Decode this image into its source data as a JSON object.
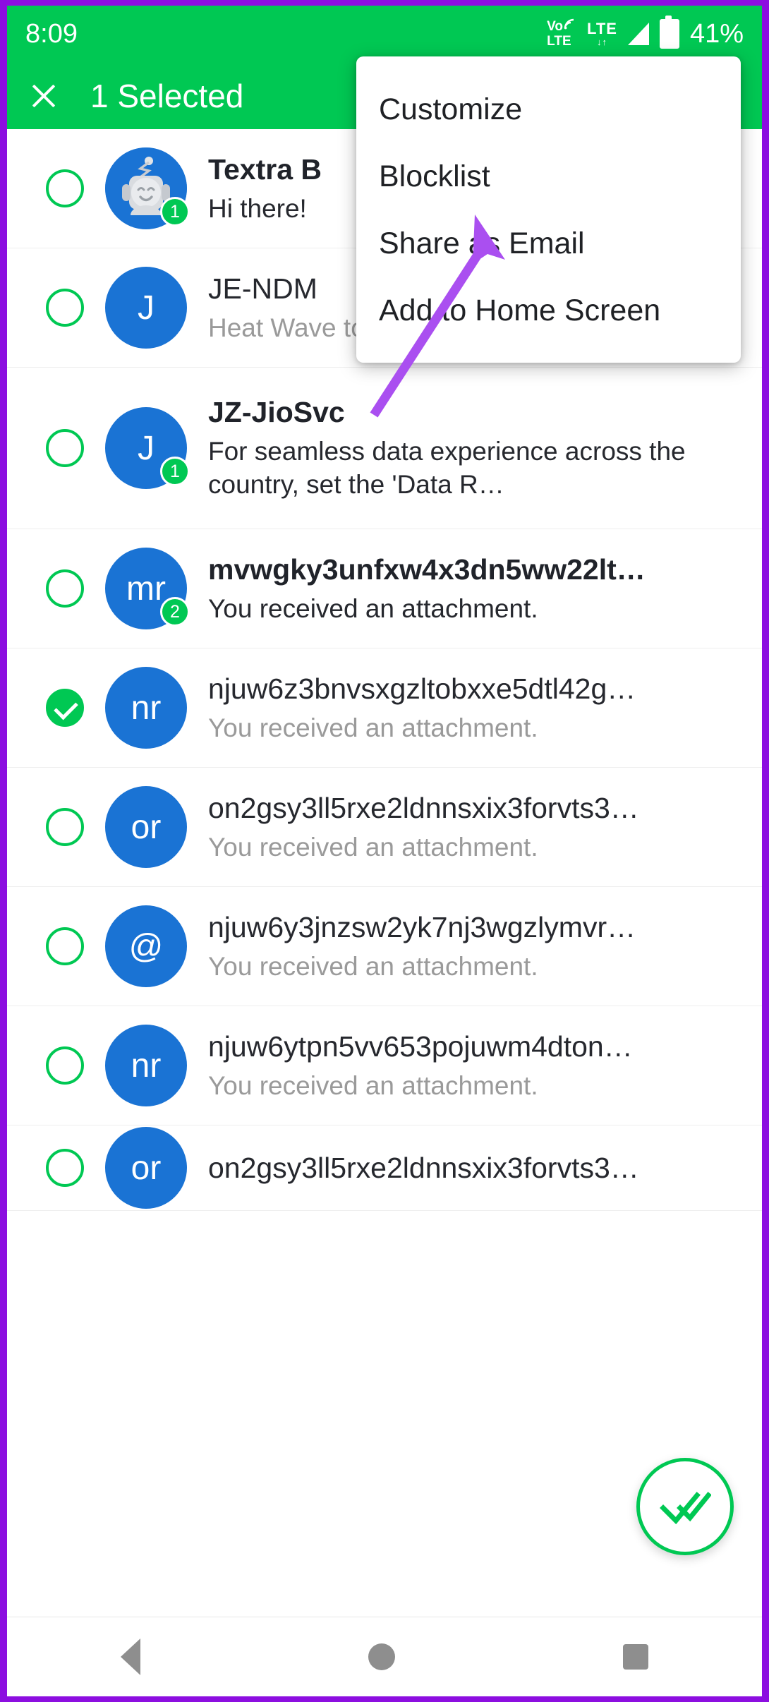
{
  "statusbar": {
    "clock": "8:09",
    "volte_top": "Vo",
    "volte_bottom": "LTE",
    "lte_label": "LTE",
    "lte_arrows": "↓↑",
    "battery_percent": "41%",
    "icons": [
      "volte-icon",
      "lte-data-icon",
      "signal-bars-icon",
      "battery-icon"
    ]
  },
  "actionbar": {
    "close_label": "✕",
    "title": "1 Selected",
    "background": "#00c853"
  },
  "popup_menu": {
    "items": [
      {
        "label": "Customize"
      },
      {
        "label": "Blocklist"
      },
      {
        "label": "Share as Email"
      },
      {
        "label": "Add to Home Screen"
      }
    ]
  },
  "conversations": [
    {
      "avatar_text": "",
      "avatar_type": "robot",
      "badge": "1",
      "title": "Textra B",
      "preview": "Hi there!",
      "unread": true,
      "selected": false,
      "two_line": false
    },
    {
      "avatar_text": "J",
      "avatar_type": "letter",
      "badge": "",
      "title": "JE-NDM",
      "preview": "Heat Wave to Severe Heat Wave c…",
      "unread": false,
      "selected": false,
      "two_line": false
    },
    {
      "avatar_text": "J",
      "avatar_type": "letter",
      "badge": "1",
      "title": "JZ-JioSvc",
      "preview": "For seamless data experience across the country, set the 'Data R…",
      "unread": true,
      "selected": false,
      "two_line": true
    },
    {
      "avatar_text": "mr",
      "avatar_type": "letter",
      "badge": "2",
      "title": "mvwgky3unfxw4x3dn5ww22lt…",
      "preview": "You received an attachment.",
      "unread": true,
      "selected": false,
      "two_line": false
    },
    {
      "avatar_text": "nr",
      "avatar_type": "letter",
      "badge": "",
      "title": "njuw6z3bnvsxgzltobxxe5dtl42g…",
      "preview": "You received an attachment.",
      "unread": false,
      "selected": true,
      "two_line": false
    },
    {
      "avatar_text": "or",
      "avatar_type": "letter",
      "badge": "",
      "title": "on2gsy3ll5rxe2ldnnsxix3forvts3…",
      "preview": "You received an attachment.",
      "unread": false,
      "selected": false,
      "two_line": false
    },
    {
      "avatar_text": "@",
      "avatar_type": "letter",
      "badge": "",
      "title": "njuw6y3jnzsw2yk7nj3wgzlymvr…",
      "preview": "You received an attachment.",
      "unread": false,
      "selected": false,
      "two_line": false
    },
    {
      "avatar_text": "nr",
      "avatar_type": "letter",
      "badge": "",
      "title": "njuw6ytpn5vv653pojuwm4dton…",
      "preview": "You received an attachment.",
      "unread": false,
      "selected": false,
      "two_line": false
    },
    {
      "avatar_text": "or",
      "avatar_type": "letter",
      "badge": "",
      "title": "on2gsy3ll5rxe2ldnnsxix3forvts3…",
      "preview": "",
      "unread": false,
      "selected": false,
      "two_line": false
    }
  ],
  "fab": {
    "icon": "double-check-icon",
    "color": "#00c853"
  },
  "navbar": {
    "items": [
      "back-icon",
      "home-icon",
      "recents-icon"
    ],
    "color": "#8e8e8e"
  },
  "annotation": {
    "arrow_color": "#aa4ff0",
    "points_to": "Share as Email"
  },
  "colors": {
    "accent_green": "#00c853",
    "avatar_blue": "#1a73d4",
    "frame_purple": "#8c0ee0",
    "muted_text": "#9a9a9a"
  }
}
